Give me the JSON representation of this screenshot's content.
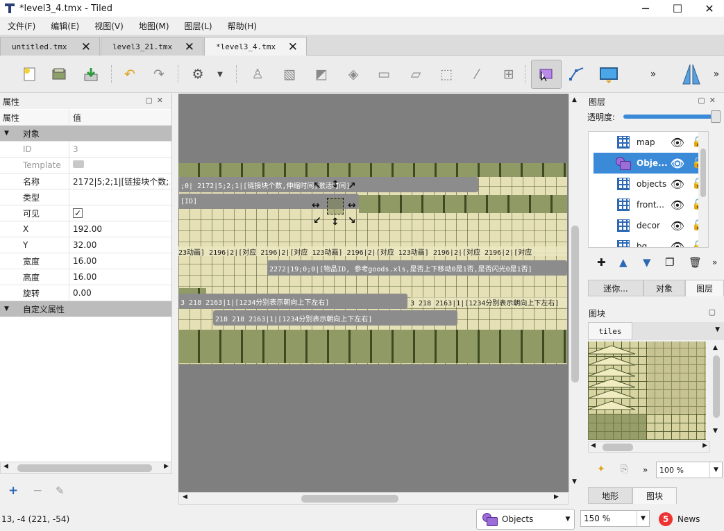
{
  "window": {
    "title": "*level3_4.tmx - Tiled",
    "minimize": "─",
    "maximize": "☐",
    "close": "✕"
  },
  "menu": [
    "文件(F)",
    "编辑(E)",
    "视图(V)",
    "地图(M)",
    "图层(L)",
    "帮助(H)"
  ],
  "tabs": [
    {
      "label": "untitled.tmx",
      "close": "✕"
    },
    {
      "label": "level3_21.tmx",
      "close": "✕"
    },
    {
      "label": "*level3_4.tmx",
      "close": "✕",
      "active": true
    }
  ],
  "toolbar": {
    "overflow": "»",
    "overflow2": "»"
  },
  "properties": {
    "panel_title": "属性",
    "col_name": "属性",
    "col_value": "值",
    "group_object": "对象",
    "rows": [
      {
        "key": "ID",
        "value": "3",
        "disabled": true
      },
      {
        "key": "Template",
        "value": "",
        "disabled": true
      },
      {
        "key": "名称",
        "value": "2172|5;2;1|[链接块个数;..."
      },
      {
        "key": "类型",
        "value": ""
      },
      {
        "key": "可见",
        "value": "✓"
      },
      {
        "key": "X",
        "value": "192.00"
      },
      {
        "key": "Y",
        "value": "32.00"
      },
      {
        "key": "宽度",
        "value": "16.00"
      },
      {
        "key": "高度",
        "value": "16.00"
      },
      {
        "key": "旋转",
        "value": "0.00"
      }
    ],
    "group_custom": "自定义属性"
  },
  "canvas_labels": [
    ";0| 2172|5;2;1|[链接块个数,伸缩时间,激活时间]",
    "[ID]",
    "23动画]   2196|2|[对应 2196|2|[对应 123动画]   2196|2|[对应 123动画]   2196|2|[对应 2196|2|[对应",
    "2272|19;0;0|[物品ID, 参考goods.xls,是否上下移动0是1否,是否闪光0是1否]",
    "3 218 2163|1|[1234分别表示朝向上下左右]",
    "3 218 2163|1|[1234分别表示朝向上下左右]",
    "218 218 2163|1|[1234分别表示朝向上下左右]"
  ],
  "layers": {
    "panel_title": "图层",
    "opacity_label": "透明度:",
    "opacity": 1.0,
    "items": [
      {
        "name": "map",
        "type": "tile"
      },
      {
        "name": "Obje...",
        "type": "object",
        "selected": true
      },
      {
        "name": "objects",
        "type": "tile"
      },
      {
        "name": "front...",
        "type": "tile"
      },
      {
        "name": "decor",
        "type": "tile"
      },
      {
        "name": "bg",
        "type": "tile"
      }
    ],
    "subtabs": [
      "迷你...",
      "对象",
      "图层"
    ]
  },
  "tilesets": {
    "panel_title": "图块",
    "tab": "tiles",
    "zoom": "100 %",
    "bottom_tabs": [
      "地形",
      "图块"
    ]
  },
  "status": {
    "coords": "13, -4 (221, -54)",
    "layer_combo": "Objects",
    "zoom_combo": "150 %",
    "news_count": "5",
    "news_label": "News"
  }
}
